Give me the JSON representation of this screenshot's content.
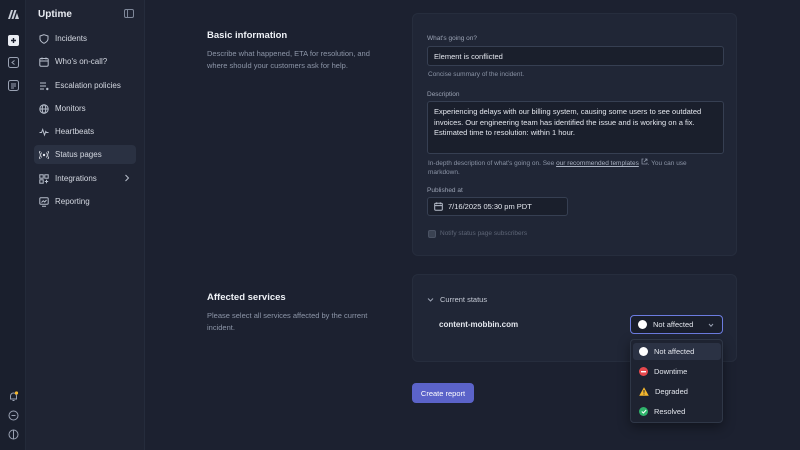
{
  "app": {
    "title": "Uptime"
  },
  "sidebar": {
    "items": [
      {
        "label": "Incidents",
        "icon": "shield-icon"
      },
      {
        "label": "Who's on-call?",
        "icon": "calendar-icon"
      },
      {
        "label": "Escalation policies",
        "icon": "list-icon"
      },
      {
        "label": "Monitors",
        "icon": "globe-icon"
      },
      {
        "label": "Heartbeats",
        "icon": "pulse-icon"
      },
      {
        "label": "Status pages",
        "icon": "broadcast-icon"
      },
      {
        "label": "Integrations",
        "icon": "grid-icon"
      },
      {
        "label": "Reporting",
        "icon": "chart-icon"
      }
    ],
    "active": "Status pages"
  },
  "basic": {
    "heading": "Basic information",
    "description": "Describe what happened, ETA for resolution, and where should your customers ask for help.",
    "whats_going_on_label": "What's going on?",
    "whats_going_on_value": "Element is conflicted",
    "whats_going_on_hint": "Concise summary of the incident.",
    "description_label": "Description",
    "description_value": "Experiencing delays with our billing system, causing some users to see outdated invoices. Our engineering team has identified the issue and is working on a fix. Estimated time to resolution: within 1 hour.",
    "description_hint_pre": "In-depth description of what's going on. See ",
    "description_hint_link": "our recommended templates",
    "description_hint_post": ". You can use markdown.",
    "published_label": "Published at",
    "published_value": "7/16/2025 05:30 pm PDT",
    "notify_label": "Notify status page subscribers"
  },
  "affected": {
    "heading": "Affected services",
    "description": "Please select all services affected by the current incident.",
    "group_label": "Current status",
    "service_name": "content-mobbin.com",
    "selected_status": "Not affected",
    "options": [
      {
        "label": "Not affected",
        "color": "#ffffff"
      },
      {
        "label": "Downtime",
        "color": "#e5484d"
      },
      {
        "label": "Degraded",
        "color": "#f5b82e"
      },
      {
        "label": "Resolved",
        "color": "#2fb36b"
      }
    ]
  },
  "actions": {
    "create_label": "Create report"
  }
}
